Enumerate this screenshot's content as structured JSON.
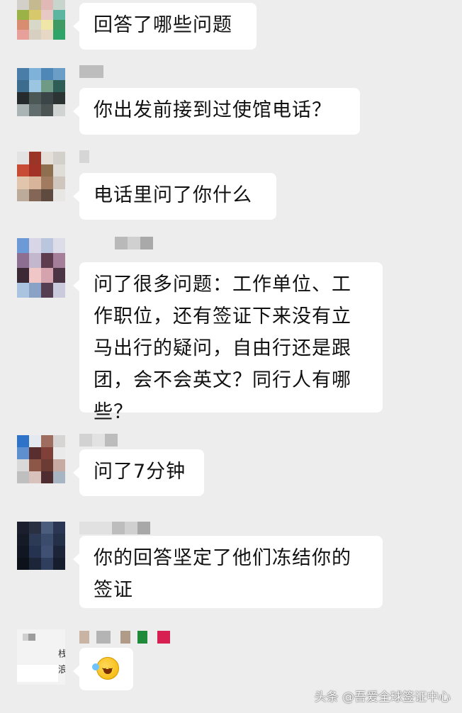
{
  "messages": [
    {
      "text": "回答了哪些问题"
    },
    {
      "text": "你出发前接到过使馆电话？"
    },
    {
      "text": "电话里问了你什么"
    },
    {
      "lines": [
        "问了很多问题：工作单位、工",
        "作职位，还有签证下来没有立",
        "马出行的疑问，自由行还是跟",
        "团，会不会英文？同行人有哪",
        "些？"
      ]
    },
    {
      "text": "问了7分钟"
    },
    {
      "lines": [
        "你的回答坚定了他们冻结你的",
        "签证"
      ]
    },
    {
      "emoji": "crying-laughing-emoji"
    }
  ],
  "partial_avatar_text": [
    "栈",
    "浪"
  ],
  "watermark": "头条 @吾爱全球签证中心",
  "colors": {
    "background": "#ededed",
    "bubble": "#ffffff",
    "text": "#111111"
  }
}
